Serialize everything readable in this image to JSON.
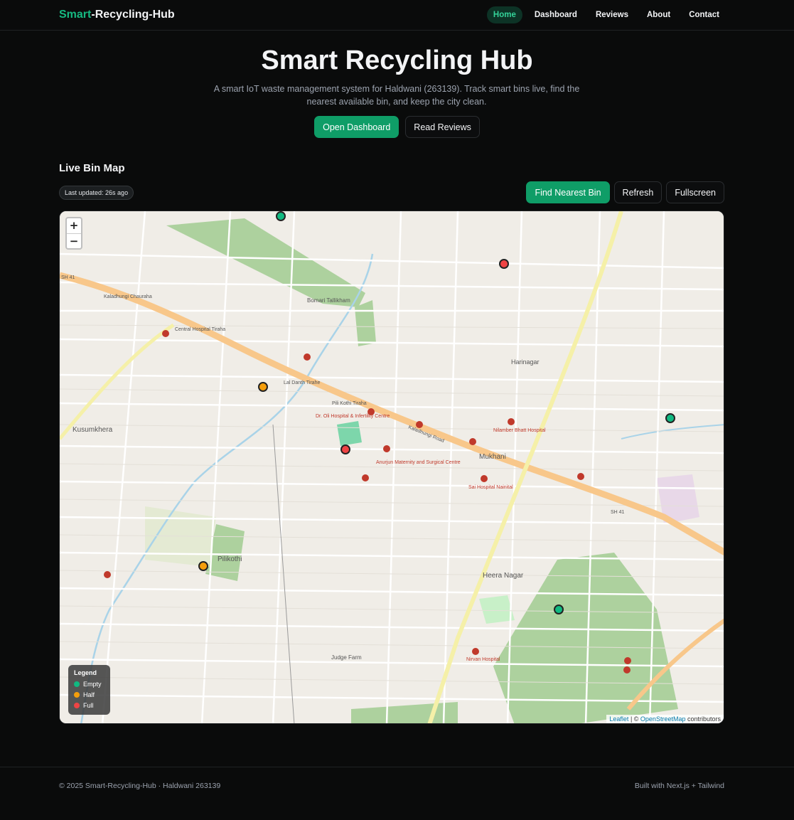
{
  "nav": {
    "brand_accent": "Smart",
    "brand_rest": "-Recycling-Hub",
    "links": [
      {
        "label": "Home",
        "active": true
      },
      {
        "label": "Dashboard",
        "active": false
      },
      {
        "label": "Reviews",
        "active": false
      },
      {
        "label": "About",
        "active": false
      },
      {
        "label": "Contact",
        "active": false
      }
    ]
  },
  "hero": {
    "title": "Smart Recycling Hub",
    "subtitle": "A smart IoT waste management system for Haldwani (263139). Track smart bins live, find the nearest available bin, and keep the city clean.",
    "primary_button": "Open Dashboard",
    "secondary_button": "Read Reviews"
  },
  "map_section": {
    "title": "Live Bin Map",
    "last_updated": "Last updated: 26s ago",
    "actions": {
      "find": "Find Nearest Bin",
      "refresh": "Refresh",
      "fullscreen": "Fullscreen"
    },
    "zoom_in": "+",
    "zoom_out": "−",
    "legend": {
      "title": "Legend",
      "items": [
        {
          "label": "Empty",
          "color": "#10b981"
        },
        {
          "label": "Half",
          "color": "#f59e0b"
        },
        {
          "label": "Full",
          "color": "#ef4444"
        }
      ]
    },
    "attribution": {
      "leaflet": "Leaflet",
      "sep": " | © ",
      "osm": "OpenStreetMap",
      "tail": " contributors"
    },
    "place_labels": [
      "Kusumkhera",
      "Mukhani",
      "Heera Nagar",
      "Pilikothi",
      "Harinagar",
      "Judge Farm",
      "Bomari Tallikham",
      "Kaladhungi Road",
      "SH 41",
      "Lal Danth Tirahe",
      "Pili Kothi Tiraha",
      "Dr. Oli Hospital & Infertility Centre",
      "Anurjun Maternity and Surgical Centre",
      "Nilamber Bhatt Hospital",
      "Sai Hospital Nainital",
      "Nirvan Hospital",
      "Central Hospital Tiraha",
      "Kaladhungi Chauraha"
    ],
    "bins": [
      {
        "status": "empty",
        "color": "#10b981"
      },
      {
        "status": "full",
        "color": "#ef4444"
      },
      {
        "status": "half",
        "color": "#f59e0b"
      },
      {
        "status": "full",
        "color": "#ef4444"
      },
      {
        "status": "empty",
        "color": "#10b981"
      },
      {
        "status": "half",
        "color": "#f59e0b"
      },
      {
        "status": "empty",
        "color": "#10b981"
      }
    ]
  },
  "footer": {
    "left": "© 2025 Smart-Recycling-Hub · Haldwani 263139",
    "right": "Built with Next.js + Tailwind"
  }
}
